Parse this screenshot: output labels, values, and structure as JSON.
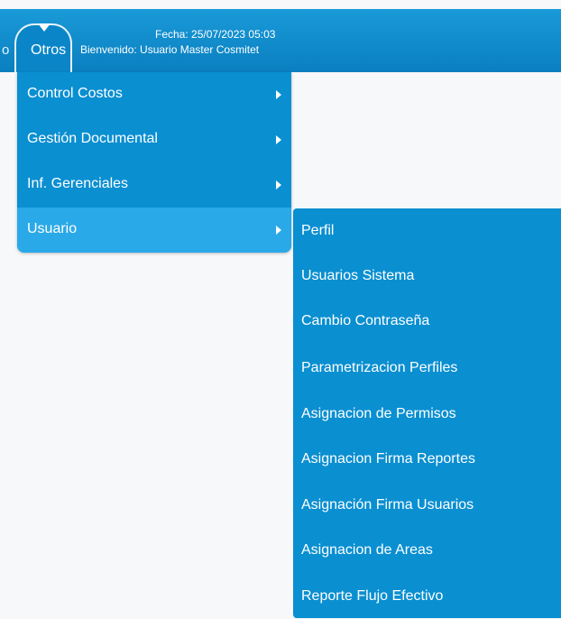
{
  "header": {
    "left_letter": "o",
    "otros_label": "Otros",
    "fecha": "Fecha: 25/07/2023 05:03",
    "bienvenido": "Bienvenido: Usuario Master Cosmitet"
  },
  "menu": {
    "items": [
      {
        "label": "Control Costos"
      },
      {
        "label": "Gestión Documental"
      },
      {
        "label": "Inf. Gerenciales"
      },
      {
        "label": "Usuario"
      }
    ]
  },
  "submenu": {
    "items": [
      {
        "label": "Perfil"
      },
      {
        "label": "Usuarios Sistema"
      },
      {
        "label": "Cambio Contraseña"
      },
      {
        "label": "Parametrizacion Perfiles"
      },
      {
        "label": "Asignacion de Permisos"
      },
      {
        "label": "Asignacion Firma Reportes"
      },
      {
        "label": "Asignación Firma Usuarios"
      },
      {
        "label": "Asignacion de Areas"
      },
      {
        "label": "Reporte Flujo Efectivo"
      }
    ]
  },
  "colors": {
    "topbar": "#0a86c8",
    "menu_bg": "#0a8fd1",
    "menu_active": "#2aa9e8",
    "page_bg": "#f7f8f9"
  }
}
